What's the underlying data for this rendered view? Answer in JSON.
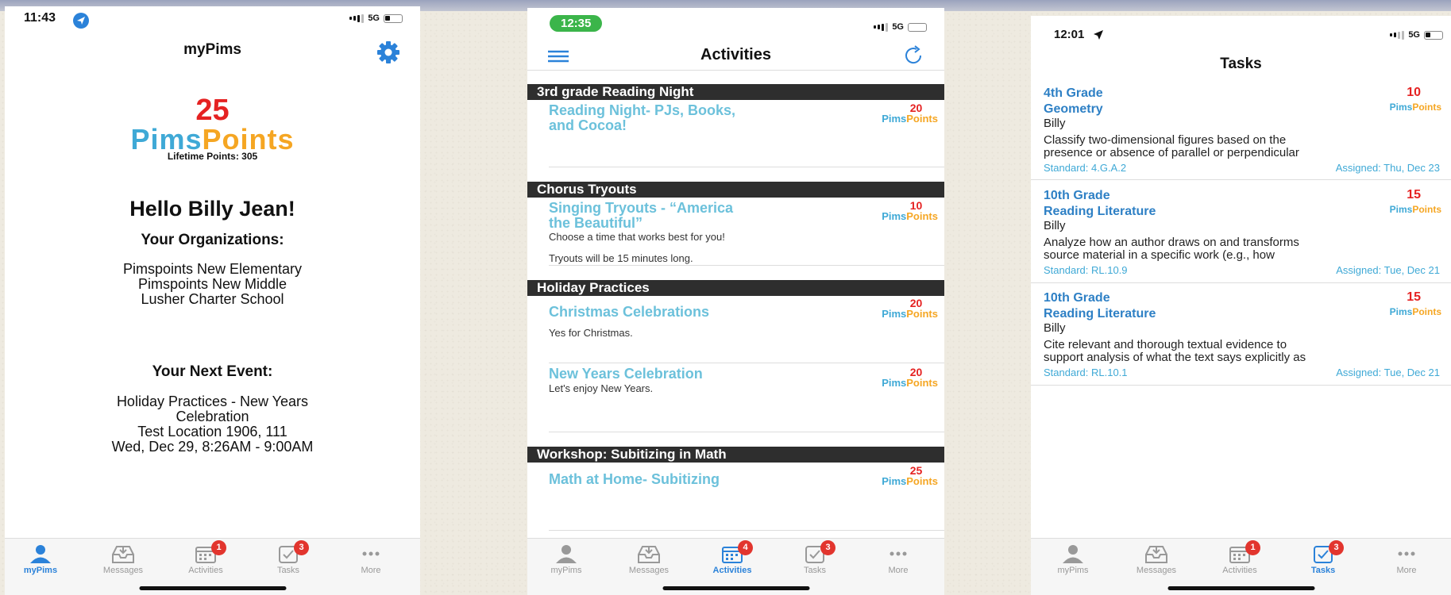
{
  "phone1": {
    "status": {
      "time": "11:43",
      "network": "5G"
    },
    "title": "myPims",
    "logo": {
      "points": "25",
      "pims": "Pims",
      "word_points": "Points"
    },
    "lifetime": "Lifetime Points: 305",
    "greeting": "Hello Billy Jean!",
    "org_heading": "Your Organizations:",
    "organizations": [
      "Pimspoints New Elementary",
      "Pimspoints New Middle",
      "Lusher Charter School"
    ],
    "event_heading": "Your Next Event:",
    "event_lines": [
      "Holiday Practices - New Years",
      "Celebration",
      "Test Location 1906, 111",
      "Wed, Dec 29, 8:26AM - 9:00AM"
    ],
    "active_tab": "myPims"
  },
  "phone2": {
    "status": {
      "time": "12:35",
      "network": "5G"
    },
    "title": "Activities",
    "sections": [
      {
        "header": "3rd grade Reading Night",
        "items": [
          {
            "title_lines": [
              "Reading Night- PJs, Books,",
              "and Cocoa!"
            ],
            "points": "20"
          }
        ]
      },
      {
        "header": "Chorus Tryouts",
        "items": [
          {
            "title_lines": [
              "Singing Tryouts - “America",
              "the Beautiful”"
            ],
            "desc": [
              "Choose a time that works best for you!",
              "Tryouts will be 15 minutes long."
            ],
            "points": "10"
          }
        ]
      },
      {
        "header": "Holiday Practices",
        "items": [
          {
            "title_lines": [
              "Christmas Celebrations"
            ],
            "desc": [
              "Yes for Christmas."
            ],
            "points": "20"
          },
          {
            "title_lines": [
              "New Years Celebration"
            ],
            "desc": [
              "Let's enjoy New Years."
            ],
            "points": "20"
          }
        ]
      },
      {
        "header": "Workshop: Subitizing in Math",
        "items": [
          {
            "title_lines": [
              "Math at Home- Subitizing"
            ],
            "points": "25"
          }
        ]
      }
    ],
    "active_tab": "Activities"
  },
  "phone3": {
    "status": {
      "time": "12:01",
      "network": "5G"
    },
    "title": "Tasks",
    "tasks": [
      {
        "grade": "4th Grade",
        "subject": "Geometry",
        "student": "Billy",
        "desc": [
          "Classify two-dimensional figures based on the",
          "presence or absence of parallel or perpendicular"
        ],
        "standard": "Standard: 4.G.A.2",
        "assigned": "Assigned: Thu, Dec 23",
        "points": "10"
      },
      {
        "grade": "10th Grade",
        "subject": "Reading Literature",
        "student": "Billy",
        "desc": [
          "Analyze how an author draws on and transforms",
          "source material in a specific work (e.g., how"
        ],
        "standard": "Standard: RL.10.9",
        "assigned": "Assigned: Tue, Dec 21",
        "points": "15"
      },
      {
        "grade": "10th Grade",
        "subject": "Reading Literature",
        "student": "Billy",
        "desc": [
          "Cite relevant and thorough textual evidence to",
          "support analysis of what the text says explicitly as"
        ],
        "standard": "Standard: RL.10.1",
        "assigned": "Assigned: Tue, Dec 21",
        "points": "15"
      }
    ],
    "logo_pims": "Pims",
    "logo_points": "Points",
    "active_tab": "Tasks"
  },
  "tabs": [
    "myPims",
    "Messages",
    "Activities",
    "Tasks",
    "More"
  ],
  "badges": {
    "activities_p1": "1",
    "tasks": "3",
    "activities_p2": "4"
  },
  "colors": {
    "accent": "#2b82d9",
    "pims_blue": "#3fa9d6",
    "points_orange": "#f5a623",
    "badge_red": "#e2352e",
    "green_pill": "#3bb54a"
  }
}
